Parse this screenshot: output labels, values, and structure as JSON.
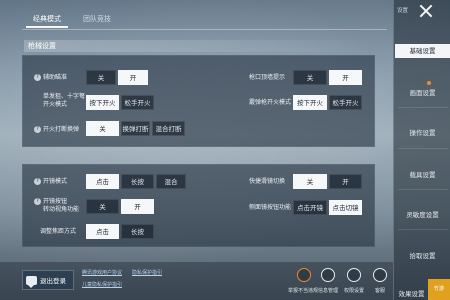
{
  "mode_tabs": [
    "经典模式",
    "团队竞技"
  ],
  "section_title": "枪械设置",
  "panel1": {
    "auto_fire": {
      "label": "辅助瞄准",
      "options": [
        "关",
        "开"
      ],
      "selected": "开"
    },
    "single_shot": {
      "label_line1": "单发狙、十字弩",
      "label_line2": "开火模式",
      "options": [
        "按下开火",
        "松手开火"
      ],
      "selected": "按下开火"
    },
    "scope_interrupt": {
      "label": "开火打断换弹",
      "options": [
        "关",
        "换弹打断",
        "混合打断"
      ],
      "selected": "关"
    },
    "muzzle_hint": {
      "label": "枪口顶墙提示",
      "options": [
        "关",
        "开"
      ],
      "selected": "开"
    },
    "shotgun_mode": {
      "label": "霰弹枪开火模式",
      "options": [
        "按下开火",
        "松手开火"
      ],
      "selected": "按下开火"
    }
  },
  "panel2": {
    "scope_mode": {
      "label": "开镜模式",
      "options": [
        "点击",
        "长按",
        "混合"
      ],
      "selected": "点击"
    },
    "scope_button": {
      "label_line1": "开镜按钮",
      "label_line2": "转动视角功能",
      "options": [
        "关",
        "开"
      ],
      "selected": "开"
    },
    "adjust_lens": {
      "label": "调整焦距方式",
      "options": [
        "点击",
        "长按"
      ],
      "selected": "点击"
    },
    "quick_switch": {
      "label": "快捷滑镜切换",
      "options": [
        "关",
        "开"
      ],
      "selected": "关"
    },
    "side_scope": {
      "label": "侧面镜按钮功能",
      "options": [
        "点击开镜",
        "点击切镜"
      ],
      "selected": "点击切镜"
    }
  },
  "sidebar": {
    "settings_word": "设置",
    "items": [
      "基础设置",
      "画面设置",
      "操作设置",
      "载具设置",
      "灵敏度设置",
      "拾取设置",
      "效果设置"
    ]
  },
  "bottom": {
    "logout": "退出登录",
    "links": [
      "腾讯游戏用户协议",
      "隐私保护指引",
      "儿童隐私保护指引"
    ],
    "icons": [
      {
        "name": "account-icon",
        "label": "举报不当违规"
      },
      {
        "name": "info-icon",
        "label": "信息管理"
      },
      {
        "name": "permission-icon",
        "label": "权限设置"
      },
      {
        "name": "service-icon",
        "label": "客服"
      }
    ],
    "brand": "竹游"
  }
}
